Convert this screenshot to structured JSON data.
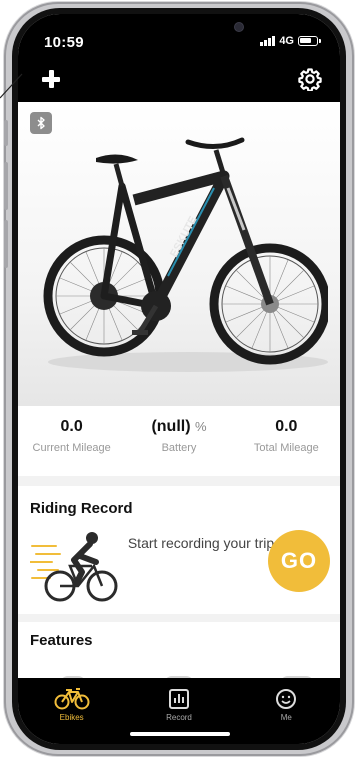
{
  "status_bar": {
    "time": "10:59",
    "network": "4G"
  },
  "header": {
    "add_icon": "plus-icon",
    "settings_icon": "gear-icon"
  },
  "hero": {
    "bluetooth_icon": "bluetooth-icon",
    "bike_brand": "ESKUTE"
  },
  "stats": {
    "current_mileage": {
      "value": "0.0",
      "label": "Current Mileage"
    },
    "battery": {
      "value": "(null)",
      "unit": "%",
      "label": "Battery"
    },
    "total_mileage": {
      "value": "0.0",
      "label": "Total Mileage"
    }
  },
  "riding_record": {
    "title": "Riding Record",
    "prompt": "Start recording your trip",
    "go_label": "GO"
  },
  "features": {
    "title": "Features"
  },
  "tabs": [
    {
      "label": "Ebikes",
      "icon": "bike-icon",
      "active": true
    },
    {
      "label": "Record",
      "icon": "chart-icon",
      "active": false
    },
    {
      "label": "Me",
      "icon": "smiley-icon",
      "active": false
    }
  ],
  "colors": {
    "accent": "#f1bd3a",
    "bar": "#000000",
    "background": "#f2f2f2"
  }
}
